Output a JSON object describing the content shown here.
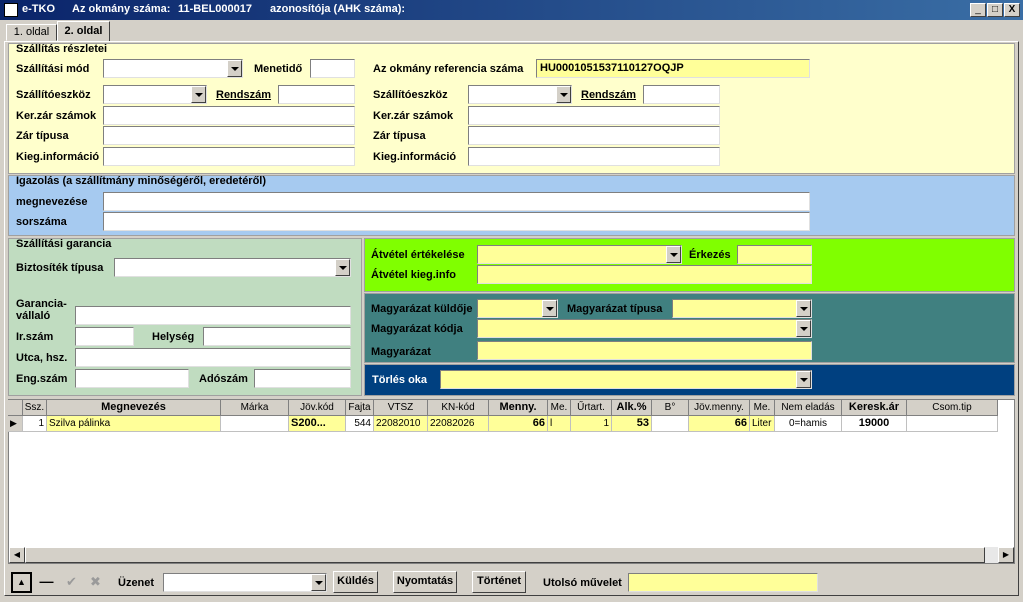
{
  "window": {
    "app": "e-TKO",
    "title_doc_label": "Az okmány száma:",
    "title_doc_value": "11-BEL000017",
    "title_ahk_label": "azonosítója (AHK száma):",
    "controls": [
      "_",
      "□",
      "X"
    ]
  },
  "tabs": [
    {
      "label": "1. oldal",
      "active": false
    },
    {
      "label": "2. oldal",
      "active": true
    }
  ],
  "szallitas": {
    "title": "Szállítás részletei",
    "mod_label": "Szállítási mód",
    "menetido_label": "Menetidő",
    "ref_label": "Az okmány referencia száma",
    "ref_value": "HU0001051537110127OQJP",
    "left": {
      "eszkoz_label": "Szállítóeszköz",
      "rendszam_label": "Rendszám",
      "kerzar_label": "Ker.zár számok",
      "zartipus_label": "Zár típusa",
      "kieg_label": "Kieg.információ"
    },
    "right": {
      "eszkoz_label": "Szállítóeszköz",
      "rendszam_label": "Rendszám",
      "kerzar_label": "Ker.zár számok",
      "zartipus_label": "Zár típusa",
      "kieg_label": "Kieg.információ"
    }
  },
  "igazolas": {
    "title": "Igazolás (a szállítmány minőségéről, eredetéről)",
    "megnevezes_label": "megnevezése",
    "sorszam_label": "sorszáma"
  },
  "garancia": {
    "title": "Szállítási garancia",
    "biztositek_label": "Biztosíték típusa",
    "vallalo_label_1": "Garancia-",
    "vallalo_label_2": "vállaló",
    "irszam_label": "Ir.szám",
    "helyseg_label": "Helység",
    "utca_label": "Utca, hsz.",
    "engszam_label": "Eng.szám",
    "adoszam_label": "Adószám"
  },
  "atvetel": {
    "ertekeles_label": "Átvétel értékelése",
    "erkezes_label": "Érkezés",
    "kieginfo_label": "Átvétel kieg.info"
  },
  "magyarazat": {
    "kuldoje_label": "Magyarázat küldője",
    "tipusa_label": "Magyarázat típusa",
    "kodja_label": "Magyarázat kódja",
    "magyarazat_label": "Magyarázat"
  },
  "torles": {
    "label": "Törlés oka"
  },
  "grid": {
    "columns": [
      {
        "label": "Ssz.",
        "bold": false
      },
      {
        "label": "Megnevezés",
        "bold": true
      },
      {
        "label": "Márka",
        "bold": false
      },
      {
        "label": "Jöv.kód",
        "bold": false
      },
      {
        "label": "Fajta",
        "bold": false
      },
      {
        "label": "VTSZ",
        "bold": false
      },
      {
        "label": "KN-kód",
        "bold": false
      },
      {
        "label": "Menny.",
        "bold": true
      },
      {
        "label": "Me.",
        "bold": false
      },
      {
        "label": "Űrtart.",
        "bold": false
      },
      {
        "label": "Alk.%",
        "bold": true
      },
      {
        "label": "B°",
        "bold": false
      },
      {
        "label": "Jöv.menny.",
        "bold": false
      },
      {
        "label": "Me.",
        "bold": false
      },
      {
        "label": "Nem eladás",
        "bold": false
      },
      {
        "label": "Keresk.ár",
        "bold": true
      },
      {
        "label": "Csom.tip",
        "bold": false
      }
    ],
    "rows": [
      [
        "1",
        "Szilva pálinka",
        "",
        "S200...",
        "544",
        "22082010",
        "22082026",
        "66",
        "l",
        "1",
        "53",
        "",
        "66",
        "Liter",
        "0=hamis",
        "19000",
        ""
      ]
    ]
  },
  "footer": {
    "uzenet_label": "Üzenet",
    "kuldes_label": "Küldés",
    "nyomtatas_label": "Nyomtatás",
    "tortenet_label": "Történet",
    "utolso_label": "Utolsó művelet"
  },
  "colors": {
    "titlebar": "#0a246a",
    "yellow_panel": "#ffffcc",
    "blue_panel": "#a6caf0",
    "green_panel": "#c0dcc0",
    "lime_panel": "#80ff00",
    "teal_panel": "#408080",
    "navy_panel": "#004080",
    "input_yellow": "#ffff99"
  }
}
